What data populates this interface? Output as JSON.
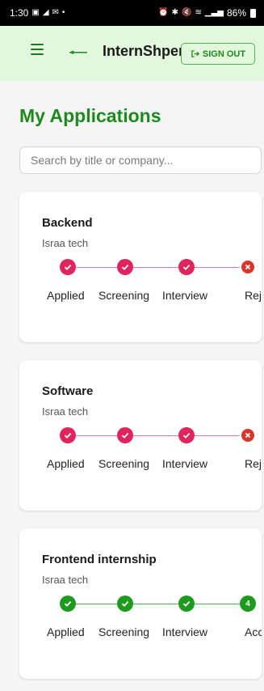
{
  "status_bar": {
    "time": "1:30",
    "battery": "86%"
  },
  "header": {
    "title": "InternShpere",
    "sign_out_label": "SIGN OUT"
  },
  "page": {
    "title": "My Applications"
  },
  "search": {
    "placeholder": "Search by title or company..."
  },
  "colors": {
    "brand_green": "#1e8a1e",
    "appbar_bg": "#e2f7dc",
    "pink": "#e0245e",
    "rejected_red": "#d9362b",
    "success_green": "#1e9a1e"
  },
  "applications": [
    {
      "title": "Backend",
      "company": "Israa tech",
      "steps": [
        {
          "label": "Applied",
          "state": "done"
        },
        {
          "label": "Screening",
          "state": "done"
        },
        {
          "label": "Interview",
          "state": "done"
        },
        {
          "label": "Rejected",
          "state": "rejected"
        }
      ]
    },
    {
      "title": "Software",
      "company": "Israa tech",
      "steps": [
        {
          "label": "Applied",
          "state": "done"
        },
        {
          "label": "Screening",
          "state": "done"
        },
        {
          "label": "Interview",
          "state": "done"
        },
        {
          "label": "Rejected",
          "state": "rejected"
        }
      ]
    },
    {
      "title": "Frontend internship",
      "company": "Israa tech",
      "steps": [
        {
          "label": "Applied",
          "state": "done-green"
        },
        {
          "label": "Screening",
          "state": "done-green"
        },
        {
          "label": "Interview",
          "state": "done-green"
        },
        {
          "label": "Accepted",
          "state": "number-green",
          "number": "4"
        }
      ]
    }
  ]
}
